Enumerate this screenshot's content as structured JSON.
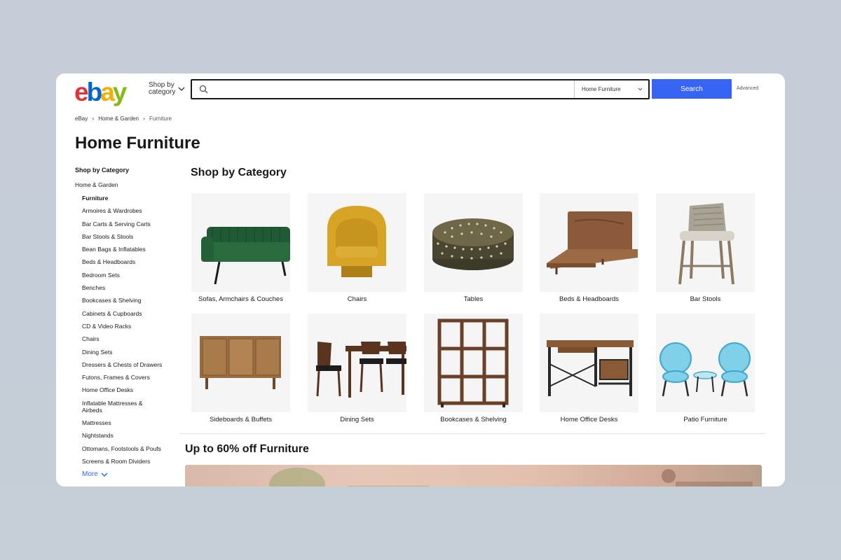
{
  "header": {
    "logo": [
      "e",
      "b",
      "a",
      "y"
    ],
    "shop_by_category": "Shop by category",
    "search_placeholder": "",
    "category_select": "Home Furniture",
    "search_button": "Search",
    "advanced": "Advanced"
  },
  "breadcrumb": [
    "eBay",
    "Home & Garden",
    "Furniture"
  ],
  "page_title": "Home Furniture",
  "sidebar": {
    "heading": "Shop by Category",
    "parent": "Home & Garden",
    "items": [
      "Furniture",
      "Armoires & Wardrobes",
      "Bar Carts & Serving Carts",
      "Bar Stools & Stools",
      "Bean Bags & Inflatables",
      "Beds & Headboards",
      "Bedroom Sets",
      "Benches",
      "Bookcases & Shelving",
      "Cabinets & Cupboards",
      "CD & Video Racks",
      "Chairs",
      "Dining Sets",
      "Dressers & Chests of Drawers",
      "Futons, Frames & Covers",
      "Home Office Desks",
      "Inflatable Mattresses & Airbeds",
      "Mattresses",
      "Nightstands",
      "Ottomans, Footstools & Poufs",
      "Screens & Room Dividers"
    ],
    "more": "More"
  },
  "main": {
    "section_title": "Shop by Category",
    "categories": [
      {
        "label": "Sofas, Armchairs & Couches",
        "icon": "sofa-icon"
      },
      {
        "label": "Chairs",
        "icon": "armchair-icon"
      },
      {
        "label": "Tables",
        "icon": "pouf-table-icon"
      },
      {
        "label": "Beds & Headboards",
        "icon": "bed-frame-icon"
      },
      {
        "label": "Bar Stools",
        "icon": "bar-stool-icon"
      },
      {
        "label": "Sideboards & Buffets",
        "icon": "sideboard-icon"
      },
      {
        "label": "Dining Sets",
        "icon": "dining-set-icon"
      },
      {
        "label": "Bookcases & Shelving",
        "icon": "bookcase-icon"
      },
      {
        "label": "Home Office Desks",
        "icon": "desk-icon"
      },
      {
        "label": "Patio Furniture",
        "icon": "patio-chairs-icon"
      }
    ],
    "promo_title": "Up to 60% off Furniture"
  },
  "colors": {
    "search_button": "#3665f3",
    "link": "#3665f3",
    "logo_e": "#e53238",
    "logo_b": "#0064d2",
    "logo_a": "#f5af02",
    "logo_y": "#86b817"
  }
}
